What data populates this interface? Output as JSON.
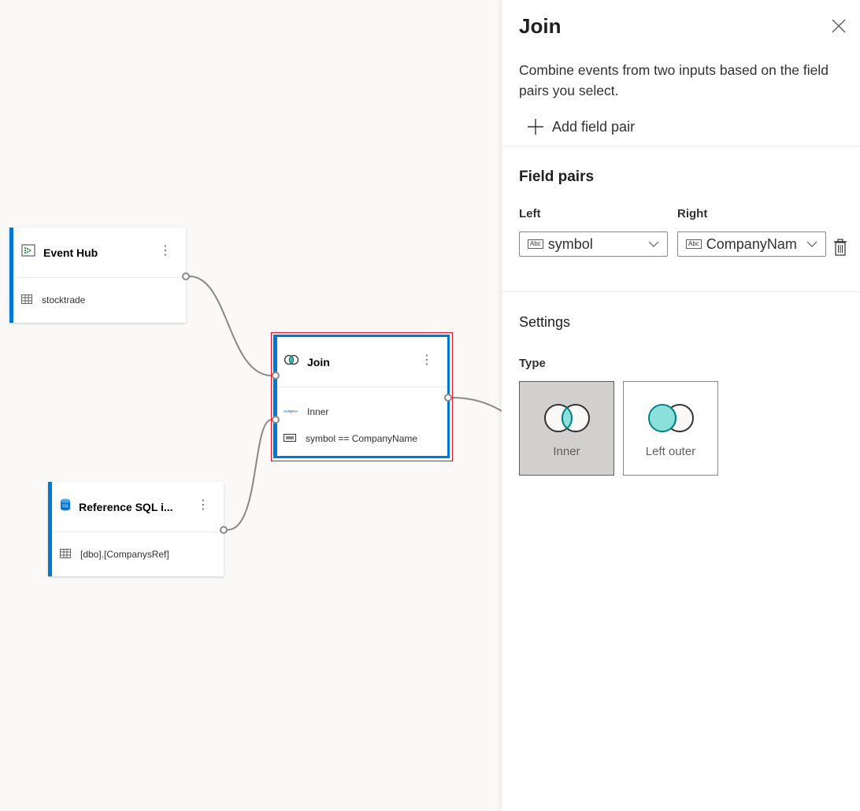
{
  "canvas": {
    "nodes": {
      "event_hub": {
        "title": "Event Hub",
        "row": "stocktrade",
        "more": "⋮"
      },
      "join": {
        "title": "Join",
        "rows": [
          "Inner",
          "symbol == CompanyName"
        ],
        "more": "⋮"
      },
      "reference_sql": {
        "title": "Reference SQL i...",
        "row": "[dbo].[CompanysRef]",
        "more": "⋮"
      }
    }
  },
  "panel": {
    "title": "Join",
    "description": "Combine events from two inputs based on the field pairs you select.",
    "add_field_pair": "Add field pair",
    "field_pairs": {
      "title": "Field pairs",
      "left_label": "Left",
      "right_label": "Right",
      "type_badge": "Abc",
      "left_value": "symbol",
      "right_value": "CompanyNam"
    },
    "settings": {
      "title": "Settings",
      "type_label": "Type",
      "types": [
        {
          "label": "Inner",
          "selected": true
        },
        {
          "label": "Left outer",
          "selected": false
        }
      ]
    }
  },
  "colors": {
    "accent": "#0078d4",
    "selection": "#e81123",
    "venn_fill": "#8ce0dc",
    "venn_stroke": "#038387"
  }
}
